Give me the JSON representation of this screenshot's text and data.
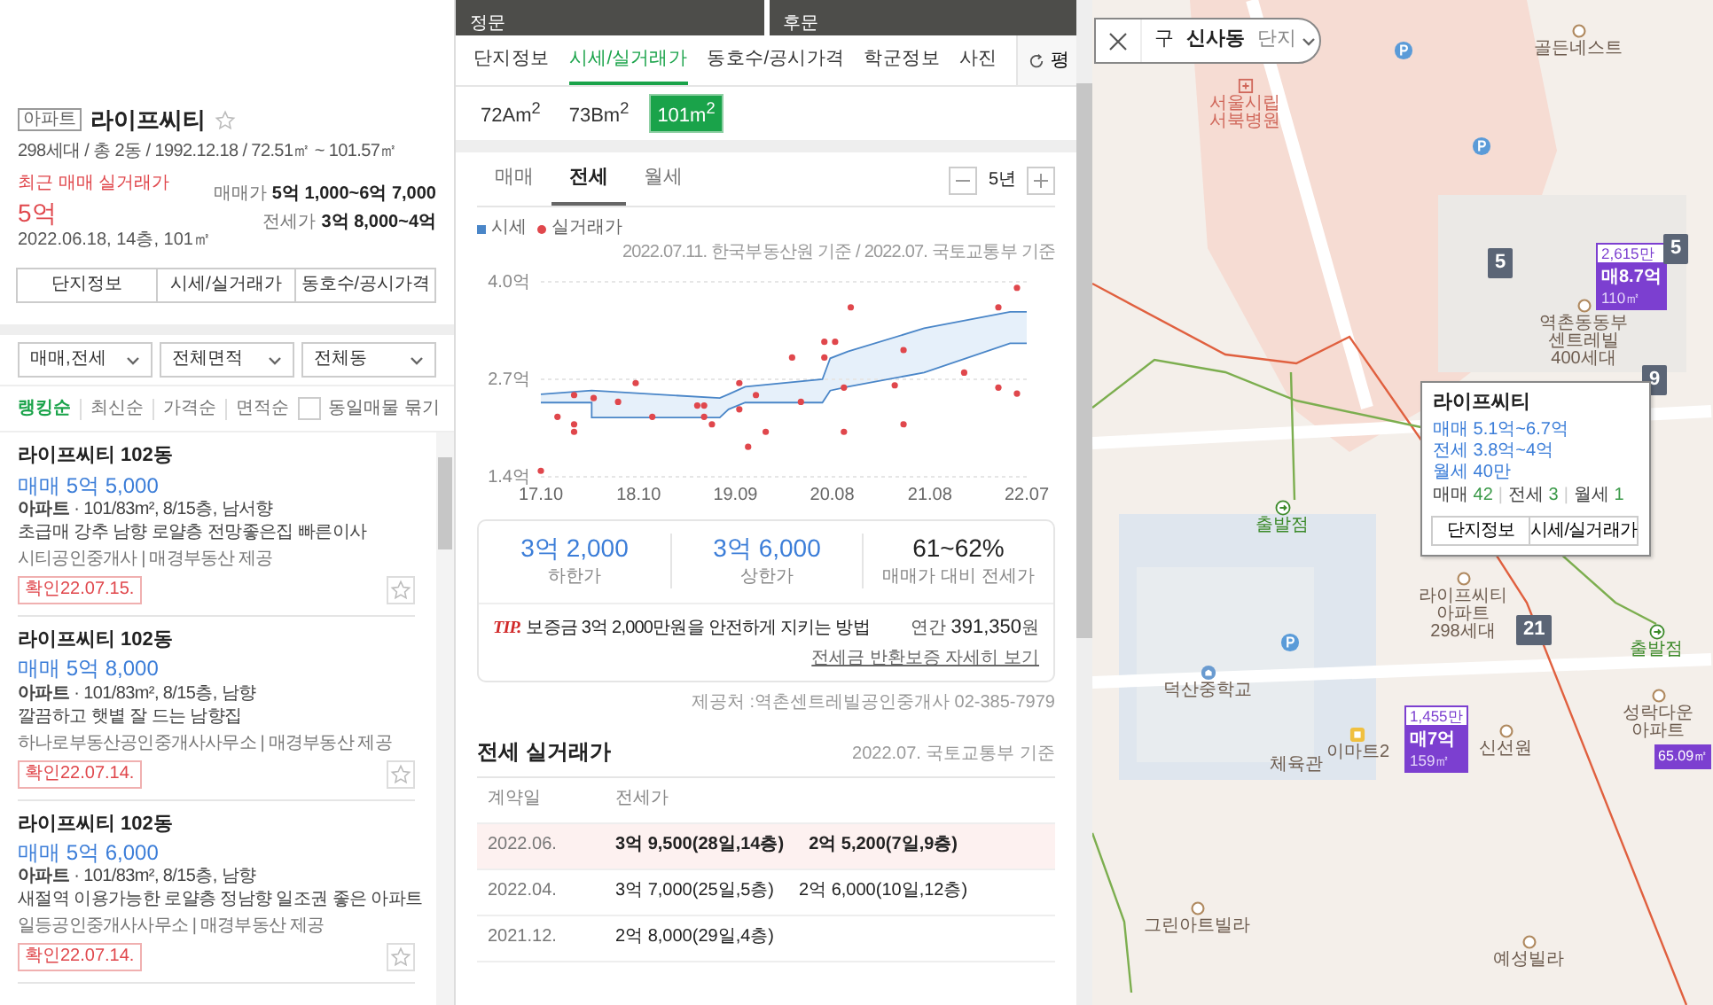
{
  "complex": {
    "type_badge": "아파트",
    "name": "라이프씨티",
    "favorite": false,
    "meta": "298세대 / 총 2동 / 1992.12.18 / 72.51㎡ ~ 101.57㎡",
    "recent_label": "최근 매매 실거래가",
    "recent_price": "5억",
    "recent_date": "2022.06.18, 14층, 101㎡",
    "price_ranges": [
      {
        "label": "매매가",
        "value": "5억 1,000~6억 7,000"
      },
      {
        "label": "전세가",
        "value": "3억 8,000~4억"
      }
    ],
    "buttons": [
      "단지정보",
      "시세/실거래가",
      "동호수/공시가격"
    ]
  },
  "filters": [
    "매매,전세",
    "전체면적",
    "전체동"
  ],
  "sort_options": [
    {
      "label": "랭킹순",
      "selected": true
    },
    {
      "label": "최신순",
      "selected": false
    },
    {
      "label": "가격순",
      "selected": false
    },
    {
      "label": "면적순",
      "selected": false
    }
  ],
  "group_same": {
    "label": "동일매물 묶기",
    "checked": false
  },
  "listings": [
    {
      "title": "라이프씨티 102동",
      "price": "매매 5억 5,000",
      "type": "아파트",
      "spec": "· 101/83m², 8/15층, 남서향",
      "note": "초급매 강추 남향 로얄층 전망좋은집 빠른이사",
      "agency": "시티공인중개사 | 매경부동산 제공",
      "confirmed": "확인22.07.15.",
      "favorite": false
    },
    {
      "title": "라이프씨티 102동",
      "price": "매매 5억 8,000",
      "type": "아파트",
      "spec": "· 101/83m², 8/15층, 남향",
      "note": "깔끔하고 햇볕 잘 드는 남향집",
      "agency": "하나로부동산공인중개사사무소 | 매경부동산 제공",
      "confirmed": "확인22.07.14.",
      "favorite": false
    },
    {
      "title": "라이프씨티 102동",
      "price": "매매 5억 6,000",
      "type": "아파트",
      "spec": "· 101/83m², 8/15층, 남향",
      "note": "새절역 이용가능한 로얄층 정남향 일조권 좋은 아파트",
      "agency": "일등공인중개사사무소 | 매경부동산 제공",
      "confirmed": "확인22.07.14.",
      "favorite": false
    }
  ],
  "photos": [
    {
      "caption": "정문"
    },
    {
      "caption": "후문"
    }
  ],
  "tabs": [
    {
      "label": "단지정보",
      "selected": false
    },
    {
      "label": "시세/실거래가",
      "selected": true
    },
    {
      "label": "동호수/공시가격",
      "selected": false
    },
    {
      "label": "학군정보",
      "selected": false
    },
    {
      "label": "사진",
      "selected": false
    }
  ],
  "unit_toggle": "평",
  "areas": [
    {
      "label": "72Am$^{2}$",
      "selected": false
    },
    {
      "label": "73Bm$^{2}$",
      "selected": false
    },
    {
      "label": "101m$^{2}$",
      "selected": true
    }
  ],
  "trade_tabs": [
    {
      "label": "매매",
      "selected": false
    },
    {
      "label": "전세",
      "selected": true
    },
    {
      "label": "월세",
      "selected": false
    }
  ],
  "period": "5년",
  "chart": {
    "source": "2022.07.11. 한국부동산원 기준 / 2022.07. 국토교통부 기준",
    "chart_data": {
      "type": "area",
      "xlim": [
        17.1,
        22.07
      ],
      "ylim": [
        1.4,
        4.0
      ],
      "xticks": [
        {
          "value": 17.1,
          "label": "17.10"
        },
        {
          "value": 18.1,
          "label": "18.10"
        },
        {
          "value": 19.09,
          "label": "19.09"
        },
        {
          "value": 20.08,
          "label": "20.08"
        },
        {
          "value": 21.08,
          "label": "21.08"
        },
        {
          "value": 22.07,
          "label": "22.07"
        }
      ],
      "yticks": [
        {
          "value": 1.4,
          "label": "1.4억"
        },
        {
          "value": 2.7,
          "label": "2.7억"
        },
        {
          "value": 4.0,
          "label": "4.0억"
        }
      ],
      "series": [
        {
          "name": "시세",
          "color": "#4a86c8",
          "x": [
            17.1,
            17.62,
            17.62,
            18.93,
            19.02,
            19.19,
            19.98,
            20.06,
            20.24,
            21.02,
            21.9,
            22.07
          ],
          "values": [
            2.5,
            2.55,
            2.55,
            2.45,
            2.5,
            2.6,
            2.7,
            2.98,
            3.07,
            3.38,
            3.6,
            3.6
          ]
        },
        {
          "color": "#4a86c8",
          "x": [
            17.1,
            17.62,
            17.62,
            18.93,
            19.02,
            19.19,
            19.98,
            20.06,
            20.24,
            21.02,
            21.9,
            22.07
          ],
          "values": [
            2.39,
            2.39,
            2.19,
            2.19,
            2.3,
            2.39,
            2.39,
            2.55,
            2.6,
            2.79,
            3.18,
            3.18
          ]
        },
        {
          "name": "실거래가",
          "type": "scatter",
          "color": "#e0474c",
          "x": [
            17.1,
            17.27,
            17.44,
            17.44,
            17.44,
            17.64,
            17.89,
            18.07,
            18.24,
            18.7,
            18.77,
            18.77,
            18.85,
            19.13,
            19.13,
            19.22,
            19.3,
            19.4,
            19.67,
            19.76,
            20.0,
            20.0,
            20.11,
            20.2,
            20.2,
            20.27,
            20.72,
            20.81,
            20.81,
            21.43,
            21.78,
            21.78,
            21.97,
            21.97
          ],
          "values": [
            1.48,
            2.2,
            2.49,
            2.1,
            2.0,
            2.45,
            2.4,
            2.65,
            2.2,
            2.35,
            2.35,
            2.2,
            2.1,
            2.65,
            2.3,
            1.8,
            2.49,
            2.0,
            2.99,
            2.4,
            3.2,
            2.99,
            3.2,
            2.59,
            2.0,
            3.66,
            2.62,
            3.09,
            2.1,
            2.79,
            3.66,
            2.59,
            3.92,
            2.51
          ]
        }
      ]
    }
  },
  "stats": [
    {
      "value": "3억 2,000",
      "label": "하한가",
      "kind": "price"
    },
    {
      "value": "3억 6,000",
      "label": "상한가",
      "kind": "price"
    },
    {
      "value": "61~62%",
      "label": "매매가 대비 전세가",
      "kind": "ratio"
    }
  ],
  "tip": {
    "tag": "TIP.",
    "text": "보증금 3억 2,000만원을 안전하게 지키는 방법",
    "annual_label": "연간",
    "annual_value": "391,350",
    "annual_unit": "원",
    "link": "전세금 반환보증 자세히 보기"
  },
  "provider_note": "제공처 :역촌센트레빌공인중개사 02-385-7979",
  "transactions": {
    "title": "전세 실거래가",
    "basis": "2022.07. 국토교통부 기준",
    "columns": [
      "계약일",
      "전세가"
    ],
    "rows": [
      {
        "date": "2022.06.",
        "deals": [
          "3억 9,500(28일,14층)",
          "2억 5,200(7일,9층)"
        ],
        "selected": true
      },
      {
        "date": "2022.04.",
        "deals": [
          "3억 7,000(25일,5층)",
          "2억 6,000(10일,12층)"
        ],
        "selected": false
      },
      {
        "date": "2021.12.",
        "deals": [
          "2억 8,000(29일,4층)"
        ],
        "selected": false
      }
    ]
  },
  "map": {
    "search": {
      "district": "구",
      "neighborhood": "신사동",
      "filter": "단지"
    },
    "places": [
      {
        "lines": [
          "서울시립",
          "서북병원"
        ],
        "kind": "hospital"
      },
      {
        "lines": [
          "골든네스트"
        ],
        "kind": "building"
      },
      {
        "lines": [
          "역촌동동부",
          "센트레빌",
          "400세대"
        ],
        "kind": "building"
      },
      {
        "lines": [
          "출발점"
        ],
        "kind": "start"
      },
      {
        "lines": [
          "라이프씨티",
          "아파트",
          "298세대"
        ],
        "kind": "building"
      },
      {
        "lines": [
          "출발점"
        ],
        "kind": "start"
      },
      {
        "lines": [
          "덕산중학교"
        ],
        "kind": "school"
      },
      {
        "lines": [
          "이마트2"
        ],
        "kind": "store"
      },
      {
        "lines": [
          "신선원"
        ],
        "kind": "building"
      },
      {
        "lines": [
          "체육관"
        ],
        "kind": "plain"
      },
      {
        "lines": [
          "성락다운",
          "아파트"
        ],
        "kind": "building"
      },
      {
        "lines": [
          "그린아트빌라"
        ],
        "kind": "building"
      },
      {
        "lines": [
          "예성빌라"
        ],
        "kind": "building"
      }
    ],
    "count_markers": [
      "5",
      "5",
      "9",
      "21"
    ],
    "price_markers": [
      {
        "top": "2,615만",
        "price": "매8.7억",
        "area": "110㎡"
      },
      {
        "top": "1,455만",
        "price": "매7억",
        "area": "159㎡"
      },
      {
        "area": "65.09㎡"
      }
    ],
    "popup": {
      "title": "라이프씨티",
      "prices": [
        "매매 5.1억~6.7억",
        "전세 3.8억~4억",
        "월세 40만"
      ],
      "separator": "|",
      "counts": [
        {
          "label": "매매",
          "count": "42"
        },
        {
          "label": "전세",
          "count": "3"
        },
        {
          "label": "월세",
          "count": "1"
        }
      ],
      "buttons": [
        "단지정보",
        "시세/실거래가"
      ]
    }
  }
}
